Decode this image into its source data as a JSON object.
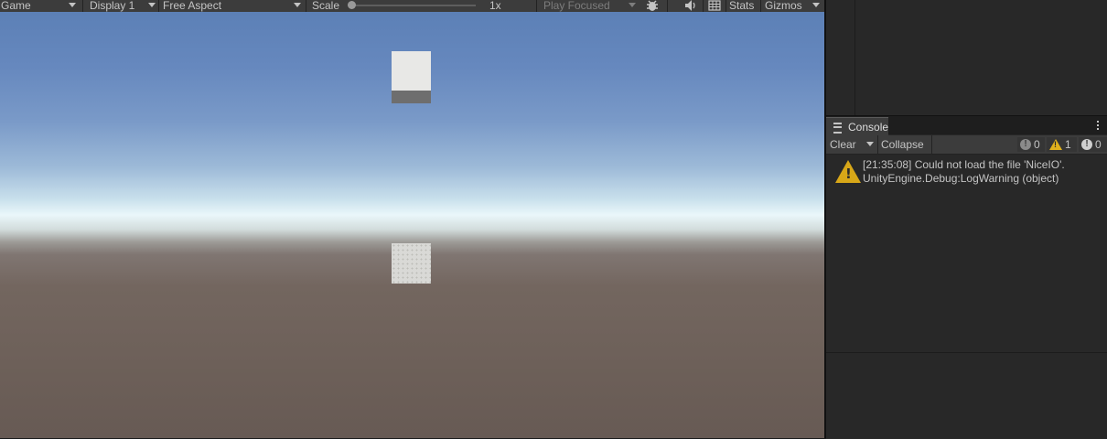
{
  "game_toolbar": {
    "tab_label": "Game",
    "display_label": "Display 1",
    "aspect_label": "Free Aspect",
    "scale_label": "Scale",
    "scale_value": "1x",
    "scale_slider_value": 0,
    "play_mode_label": "Play Focused",
    "stats_label": "Stats",
    "gizmos_label": "Gizmos"
  },
  "console": {
    "tab_label": "Console",
    "toolbar": {
      "clear_label": "Clear",
      "collapse_label": "Collapse",
      "error_count": "0",
      "warning_count": "1",
      "info_count": "0"
    },
    "entries": [
      {
        "type": "warning",
        "line1": "[21:35:08] Could not load the file 'NiceIO'.",
        "line2": "UnityEngine.Debug:LogWarning (object)"
      }
    ]
  },
  "colors": {
    "toolbar_bg": "#3c3c3c",
    "panel_bg": "#282828",
    "warning_yellow": "#d7a718",
    "text": "#c4c4c4"
  },
  "icons": {
    "bug": "bug-icon",
    "audio": "speaker-icon",
    "grid": "grid-icon",
    "console_tab": "list-icon",
    "warning": "warning-icon"
  }
}
